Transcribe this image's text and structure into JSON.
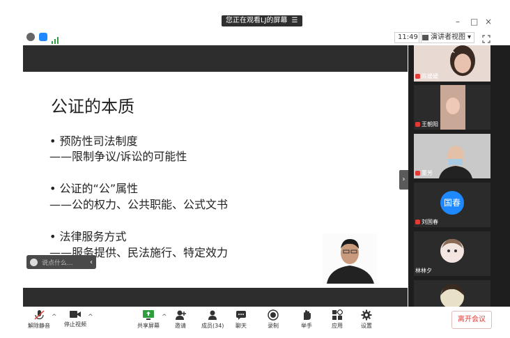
{
  "window": {
    "banner_text": "您正在观看LJ的屏幕",
    "banner_menu_icon": "menu-icon",
    "minimize": "–",
    "maximize": "□",
    "close": "×"
  },
  "status": {
    "time": "11:49",
    "view_label": "演讲者视图",
    "view_caret": "▾"
  },
  "slide": {
    "title": "公证的本质",
    "items": [
      {
        "bullet": "• 预防性司法制度",
        "detail": "——限制争议/诉讼的可能性"
      },
      {
        "bullet": "• 公证的“公”属性",
        "detail": "——公的权力、公共职能、公式文书"
      },
      {
        "bullet": "• 法律服务方式",
        "detail": "——服务提供、民法施行、特定效力"
      }
    ],
    "comment_placeholder": "说点什么...",
    "comment_arrow": "‹"
  },
  "participants": [
    {
      "name": "陈嫒嫒",
      "type": "video"
    },
    {
      "name": "王朝阳",
      "type": "video"
    },
    {
      "name": "董芳",
      "type": "video"
    },
    {
      "name": "刘国春",
      "type": "avatar",
      "avatar_text": "国春"
    },
    {
      "name": "林林夕",
      "type": "image"
    },
    {
      "name": "",
      "type": "image"
    }
  ],
  "panel": {
    "collapse_arrow": "›",
    "scroll_up": "⌃"
  },
  "toolbar": {
    "unmute": "解除静音",
    "stop_video": "停止视频",
    "share_screen": "共享屏幕",
    "invite": "邀请",
    "members": "成员(34)",
    "chat": "聊天",
    "record": "录制",
    "raise_hand": "举手",
    "apps": "应用",
    "settings": "设置",
    "leave": "离开会议",
    "caret": "^"
  },
  "colors": {
    "accent_blue": "#1e88ff",
    "leave_red": "#e53935",
    "share_green": "#2e9e3e",
    "dark_bar": "#2d2d2d",
    "panel_bg": "#1e1e1e"
  }
}
